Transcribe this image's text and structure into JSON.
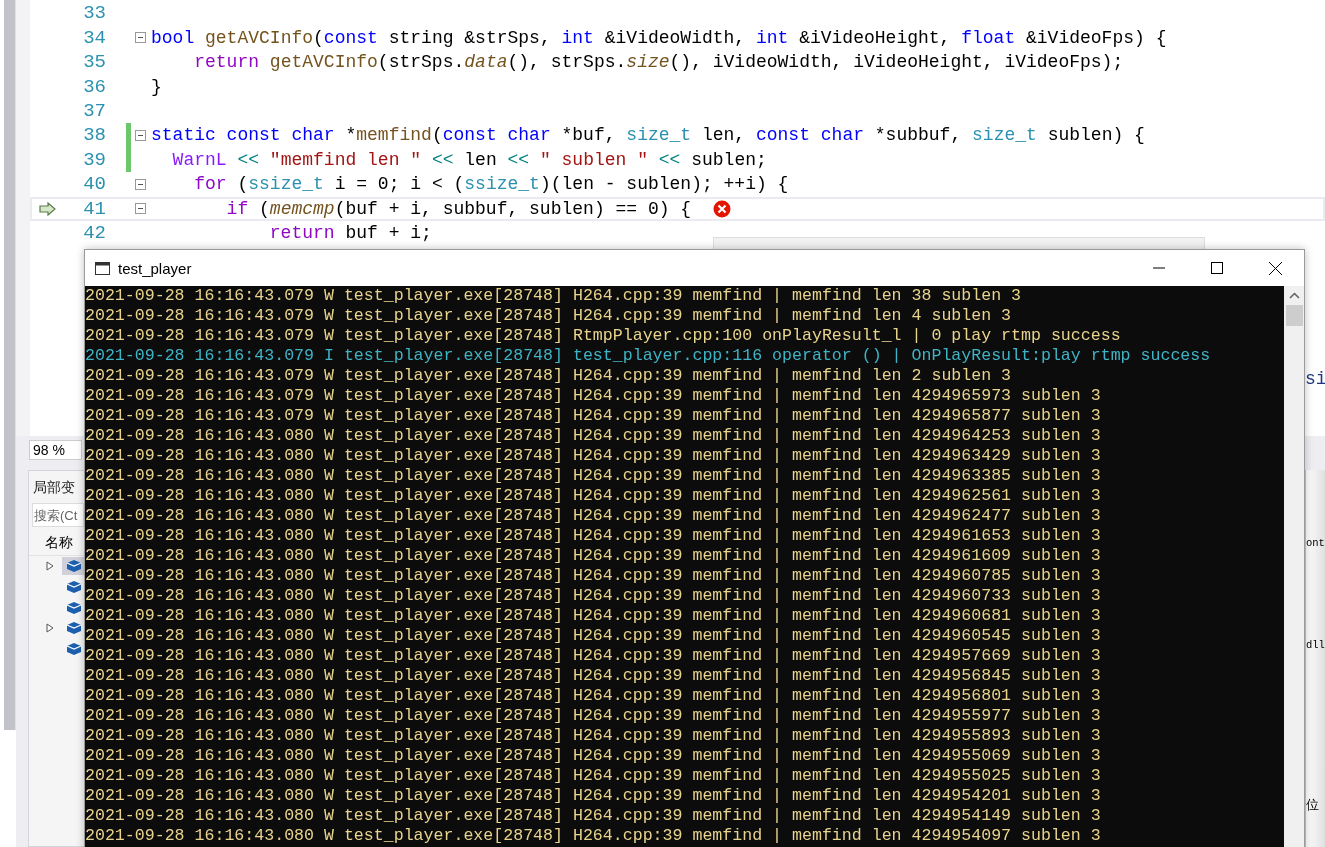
{
  "editor": {
    "lines": [
      {
        "number": "33",
        "fold": false,
        "changed": false,
        "current": false,
        "pointer": false,
        "error": false
      },
      {
        "number": "34",
        "fold": true,
        "changed": false,
        "current": false,
        "pointer": false,
        "error": false,
        "tokens": [
          {
            "text": "bool",
            "kind": "kw"
          },
          {
            "text": " getAVCInfo",
            "kind": "fn"
          },
          {
            "text": "(",
            "kind": "plain"
          },
          {
            "text": "const",
            "kind": "kw"
          },
          {
            "text": " string &strSps, ",
            "kind": "plain"
          },
          {
            "text": "int",
            "kind": "kw"
          },
          {
            "text": " &iVideoWidth, ",
            "kind": "plain"
          },
          {
            "text": "int",
            "kind": "kw"
          },
          {
            "text": " &iVideoHeight, ",
            "kind": "plain"
          },
          {
            "text": "float",
            "kind": "kw"
          },
          {
            "text": " &iVideoFps) {",
            "kind": "plain"
          }
        ]
      },
      {
        "number": "35",
        "fold": false,
        "changed": false,
        "current": false,
        "pointer": false,
        "error": false,
        "tokens": [
          {
            "text": "    return",
            "kind": "ctl"
          },
          {
            "text": " getAVCInfo",
            "kind": "fn"
          },
          {
            "text": "(strSps.",
            "kind": "plain"
          },
          {
            "text": "data",
            "kind": "member"
          },
          {
            "text": "(), strSps.",
            "kind": "plain"
          },
          {
            "text": "size",
            "kind": "member"
          },
          {
            "text": "(), iVideoWidth, iVideoHeight, iVideoFps);",
            "kind": "plain"
          }
        ]
      },
      {
        "number": "36",
        "fold": false,
        "changed": false,
        "current": false,
        "pointer": false,
        "error": false,
        "tokens": [
          {
            "text": "}",
            "kind": "plain"
          }
        ]
      },
      {
        "number": "37",
        "fold": false,
        "changed": false,
        "current": false,
        "pointer": false,
        "error": false
      },
      {
        "number": "38",
        "fold": true,
        "changed": true,
        "current": false,
        "pointer": false,
        "error": false,
        "tokens": [
          {
            "text": "static",
            "kind": "kw"
          },
          {
            "text": " const",
            "kind": "kw"
          },
          {
            "text": " char",
            "kind": "kw"
          },
          {
            "text": " *",
            "kind": "plain"
          },
          {
            "text": "memfind",
            "kind": "fn"
          },
          {
            "text": "(",
            "kind": "plain"
          },
          {
            "text": "const",
            "kind": "kw"
          },
          {
            "text": " char",
            "kind": "kw"
          },
          {
            "text": " *buf, ",
            "kind": "plain"
          },
          {
            "text": "size_t",
            "kind": "type"
          },
          {
            "text": " len, ",
            "kind": "plain"
          },
          {
            "text": "const",
            "kind": "kw"
          },
          {
            "text": " char",
            "kind": "kw"
          },
          {
            "text": " *subbuf, ",
            "kind": "plain"
          },
          {
            "text": "size_t",
            "kind": "type"
          },
          {
            "text": " sublen) {",
            "kind": "plain"
          }
        ]
      },
      {
        "number": "39",
        "fold": false,
        "changed": true,
        "current": false,
        "pointer": false,
        "error": false,
        "tokens": [
          {
            "text": "  WarnL",
            "kind": "macro"
          },
          {
            "text": " << ",
            "kind": "op"
          },
          {
            "text": "\"memfind len \"",
            "kind": "str"
          },
          {
            "text": " << ",
            "kind": "op"
          },
          {
            "text": "len",
            "kind": "plain"
          },
          {
            "text": " << ",
            "kind": "op"
          },
          {
            "text": "\" sublen \"",
            "kind": "str"
          },
          {
            "text": " << ",
            "kind": "op"
          },
          {
            "text": "sublen;",
            "kind": "plain"
          }
        ]
      },
      {
        "number": "40",
        "fold": true,
        "changed": false,
        "current": false,
        "pointer": false,
        "error": false,
        "tokens": [
          {
            "text": "    for",
            "kind": "ctl"
          },
          {
            "text": " (",
            "kind": "plain"
          },
          {
            "text": "ssize_t",
            "kind": "type"
          },
          {
            "text": " i = 0; i < (",
            "kind": "plain"
          },
          {
            "text": "ssize_t",
            "kind": "type"
          },
          {
            "text": ")(len - sublen); ++i) {",
            "kind": "plain"
          }
        ]
      },
      {
        "number": "41",
        "fold": true,
        "changed": false,
        "current": true,
        "pointer": true,
        "error": true,
        "tokens": [
          {
            "text": "       if",
            "kind": "ctl"
          },
          {
            "text": " (",
            "kind": "plain"
          },
          {
            "text": "memcmp",
            "kind": "member"
          },
          {
            "text": "(buf + i, subbuf, sublen) == 0) {",
            "kind": "plain"
          }
        ]
      },
      {
        "number": "42",
        "fold": false,
        "changed": false,
        "current": false,
        "pointer": false,
        "error": false,
        "tokens": [
          {
            "text": "           return",
            "kind": "ctl"
          },
          {
            "text": " buf + i;",
            "kind": "plain"
          }
        ]
      }
    ],
    "fragment": "si"
  },
  "zoom": "98 %",
  "locals": {
    "title": "局部变",
    "search_placeholder": "搜索(Ct",
    "column": "名称",
    "rows": [
      {
        "expandable": true,
        "selected": true
      },
      {
        "expandable": false,
        "selected": false
      },
      {
        "expandable": false,
        "selected": false
      },
      {
        "expandable": true,
        "selected": false
      },
      {
        "expandable": false,
        "selected": false
      }
    ]
  },
  "side_panel": {
    "fragments": [
      "ont",
      "dll",
      "位"
    ]
  },
  "console": {
    "title": "test_player",
    "lines": [
      {
        "kind": "warn",
        "text": "2021-09-28 16:16:43.079 W test_player.exe[28748] H264.cpp:39 memfind | memfind len 38 sublen 3"
      },
      {
        "kind": "warn",
        "text": "2021-09-28 16:16:43.079 W test_player.exe[28748] H264.cpp:39 memfind | memfind len 4 sublen 3"
      },
      {
        "kind": "warn",
        "text": "2021-09-28 16:16:43.079 W test_player.exe[28748] RtmpPlayer.cpp:100 onPlayResult_l | 0 play rtmp success"
      },
      {
        "kind": "info",
        "text": "2021-09-28 16:16:43.079 I test_player.exe[28748] test_player.cpp:116 operator () | OnPlayResult:play rtmp success"
      },
      {
        "kind": "warn",
        "text": "2021-09-28 16:16:43.079 W test_player.exe[28748] H264.cpp:39 memfind | memfind len 2 sublen 3"
      },
      {
        "kind": "warn",
        "text": "2021-09-28 16:16:43.079 W test_player.exe[28748] H264.cpp:39 memfind | memfind len 4294965973 sublen 3"
      },
      {
        "kind": "warn",
        "text": "2021-09-28 16:16:43.079 W test_player.exe[28748] H264.cpp:39 memfind | memfind len 4294965877 sublen 3"
      },
      {
        "kind": "warn",
        "text": "2021-09-28 16:16:43.080 W test_player.exe[28748] H264.cpp:39 memfind | memfind len 4294964253 sublen 3"
      },
      {
        "kind": "warn",
        "text": "2021-09-28 16:16:43.080 W test_player.exe[28748] H264.cpp:39 memfind | memfind len 4294963429 sublen 3"
      },
      {
        "kind": "warn",
        "text": "2021-09-28 16:16:43.080 W test_player.exe[28748] H264.cpp:39 memfind | memfind len 4294963385 sublen 3"
      },
      {
        "kind": "warn",
        "text": "2021-09-28 16:16:43.080 W test_player.exe[28748] H264.cpp:39 memfind | memfind len 4294962561 sublen 3"
      },
      {
        "kind": "warn",
        "text": "2021-09-28 16:16:43.080 W test_player.exe[28748] H264.cpp:39 memfind | memfind len 4294962477 sublen 3"
      },
      {
        "kind": "warn",
        "text": "2021-09-28 16:16:43.080 W test_player.exe[28748] H264.cpp:39 memfind | memfind len 4294961653 sublen 3"
      },
      {
        "kind": "warn",
        "text": "2021-09-28 16:16:43.080 W test_player.exe[28748] H264.cpp:39 memfind | memfind len 4294961609 sublen 3"
      },
      {
        "kind": "warn",
        "text": "2021-09-28 16:16:43.080 W test_player.exe[28748] H264.cpp:39 memfind | memfind len 4294960785 sublen 3"
      },
      {
        "kind": "warn",
        "text": "2021-09-28 16:16:43.080 W test_player.exe[28748] H264.cpp:39 memfind | memfind len 4294960733 sublen 3"
      },
      {
        "kind": "warn",
        "text": "2021-09-28 16:16:43.080 W test_player.exe[28748] H264.cpp:39 memfind | memfind len 4294960681 sublen 3"
      },
      {
        "kind": "warn",
        "text": "2021-09-28 16:16:43.080 W test_player.exe[28748] H264.cpp:39 memfind | memfind len 4294960545 sublen 3"
      },
      {
        "kind": "warn",
        "text": "2021-09-28 16:16:43.080 W test_player.exe[28748] H264.cpp:39 memfind | memfind len 4294957669 sublen 3"
      },
      {
        "kind": "warn",
        "text": "2021-09-28 16:16:43.080 W test_player.exe[28748] H264.cpp:39 memfind | memfind len 4294956845 sublen 3"
      },
      {
        "kind": "warn",
        "text": "2021-09-28 16:16:43.080 W test_player.exe[28748] H264.cpp:39 memfind | memfind len 4294956801 sublen 3"
      },
      {
        "kind": "warn",
        "text": "2021-09-28 16:16:43.080 W test_player.exe[28748] H264.cpp:39 memfind | memfind len 4294955977 sublen 3"
      },
      {
        "kind": "warn",
        "text": "2021-09-28 16:16:43.080 W test_player.exe[28748] H264.cpp:39 memfind | memfind len 4294955893 sublen 3"
      },
      {
        "kind": "warn",
        "text": "2021-09-28 16:16:43.080 W test_player.exe[28748] H264.cpp:39 memfind | memfind len 4294955069 sublen 3"
      },
      {
        "kind": "warn",
        "text": "2021-09-28 16:16:43.080 W test_player.exe[28748] H264.cpp:39 memfind | memfind len 4294955025 sublen 3"
      },
      {
        "kind": "warn",
        "text": "2021-09-28 16:16:43.080 W test_player.exe[28748] H264.cpp:39 memfind | memfind len 4294954201 sublen 3"
      },
      {
        "kind": "warn",
        "text": "2021-09-28 16:16:43.080 W test_player.exe[28748] H264.cpp:39 memfind | memfind len 4294954149 sublen 3"
      },
      {
        "kind": "warn",
        "text": "2021-09-28 16:16:43.080 W test_player.exe[28748] H264.cpp:39 memfind | memfind len 4294954097 sublen 3"
      }
    ]
  }
}
